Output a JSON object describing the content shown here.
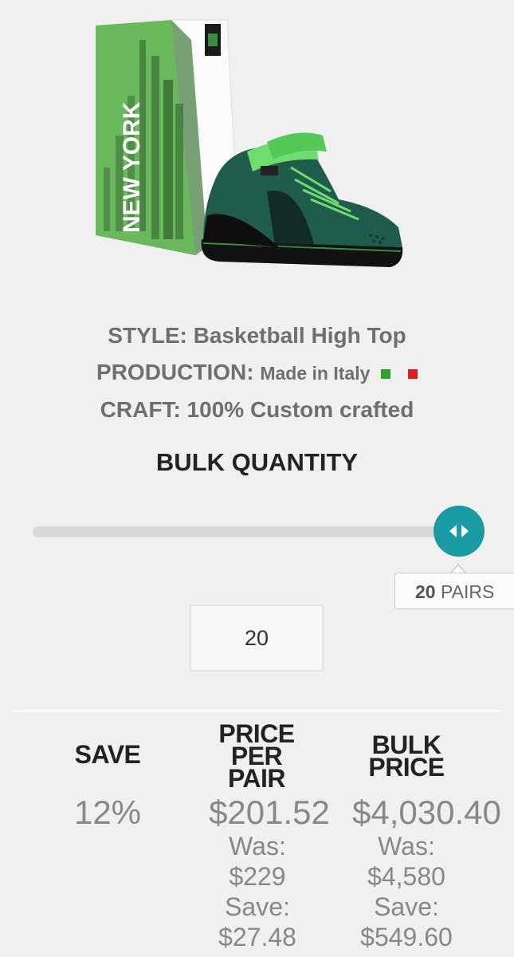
{
  "product": {
    "box_text": "NEW YORK",
    "image_name": "basketball-high-top-green-with-new-york-box"
  },
  "specs": {
    "style_label": "STYLE:",
    "style_value": "Basketball High Top",
    "production_label": "PRODUCTION:",
    "production_value": "Made in Italy",
    "craft_label": "CRAFT:",
    "craft_value": "100% Custom crafted"
  },
  "bulk": {
    "title": "BULK QUANTITY",
    "slider_level": 1.0,
    "tooltip_value": "20",
    "tooltip_unit": "PAIRS",
    "quantity_value": "20"
  },
  "pricing": {
    "save_header": "SAVE",
    "price_header_line1": "PRICE",
    "price_header_line2": "PER",
    "price_header_line3": "PAIR",
    "bulk_header_line1": "BULK",
    "bulk_header_line2": "PRICE",
    "save_value": "12%",
    "price_per_pair": "$201.52",
    "price_was_label": "Was:",
    "price_was_value": "$229",
    "price_save_label": "Save:",
    "price_save_value": "$27.48",
    "bulk_price": "$4,030.40",
    "bulk_was_label": "Was:",
    "bulk_was_value": "$4,580",
    "bulk_save_label": "Save:",
    "bulk_save_value": "$549.60"
  },
  "colors": {
    "accent": "#1a9ba3",
    "flag_green": "#2aa52a",
    "flag_red": "#e01b1b"
  }
}
